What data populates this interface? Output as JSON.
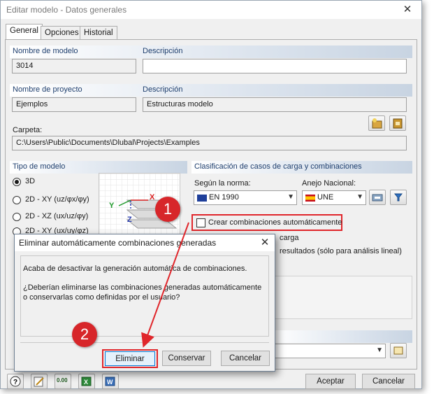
{
  "window": {
    "title": "Editar modelo - Datos generales"
  },
  "tabs": [
    {
      "label": "General"
    },
    {
      "label": "Opciones"
    },
    {
      "label": "Historial"
    }
  ],
  "model": {
    "name_header": "Nombre de modelo",
    "desc_header": "Descripción",
    "name_value": "3014",
    "desc_value": ""
  },
  "project": {
    "name_header": "Nombre de proyecto",
    "desc_header": "Descripción",
    "name_value": "Ejemplos",
    "desc_value": "Estructuras modelo",
    "folder_label": "Carpeta:",
    "folder_value": "C:\\Users\\Public\\Documents\\Dlubal\\Projects\\Examples"
  },
  "model_type": {
    "header": "Tipo de modelo",
    "options": [
      {
        "label": "3D",
        "selected": true
      },
      {
        "label": "2D - XY (uz/φx/φy)",
        "selected": false
      },
      {
        "label": "2D - XZ (ux/uz/φy)",
        "selected": false
      },
      {
        "label": "2D - XY (ux/uy/φz)",
        "selected": false
      }
    ],
    "axis_labels": {
      "x": "X",
      "y": "Y",
      "z": "Z"
    }
  },
  "classification": {
    "header": "Clasificación de casos de carga y combinaciones",
    "norm_label": "Según la norma:",
    "norm_value": "EN 1990",
    "annex_label": "Anejo Nacional:",
    "annex_value": "UNE",
    "auto_combos_label": "Crear combinaciones automáticamente",
    "auto_combos_checked": false,
    "partial_text_1": "carga",
    "partial_text_2": "resultados (sólo para análisis lineal)"
  },
  "dialog": {
    "title": "Eliminar automáticamente combinaciones generadas",
    "line1": "Acaba de desactivar la generación automática de combinaciones.",
    "line2": "¿Deberían eliminarse las combinaciones generadas automáticamente",
    "line3": "o conservarlas como definidas por el usuario?",
    "delete_label": "Eliminar",
    "keep_label": "Conservar",
    "cancel_label": "Cancelar"
  },
  "footer": {
    "ok_label": "Aceptar",
    "cancel_label": "Cancelar",
    "units_icon_text": "0.00"
  },
  "annotations": {
    "badge1": "1",
    "badge2": "2",
    "color": "#d7262a"
  },
  "colors": {
    "section_header_text": "#1f3f6e",
    "accent_blue": "#2d6fc0",
    "highlight_red": "#e0262b"
  }
}
